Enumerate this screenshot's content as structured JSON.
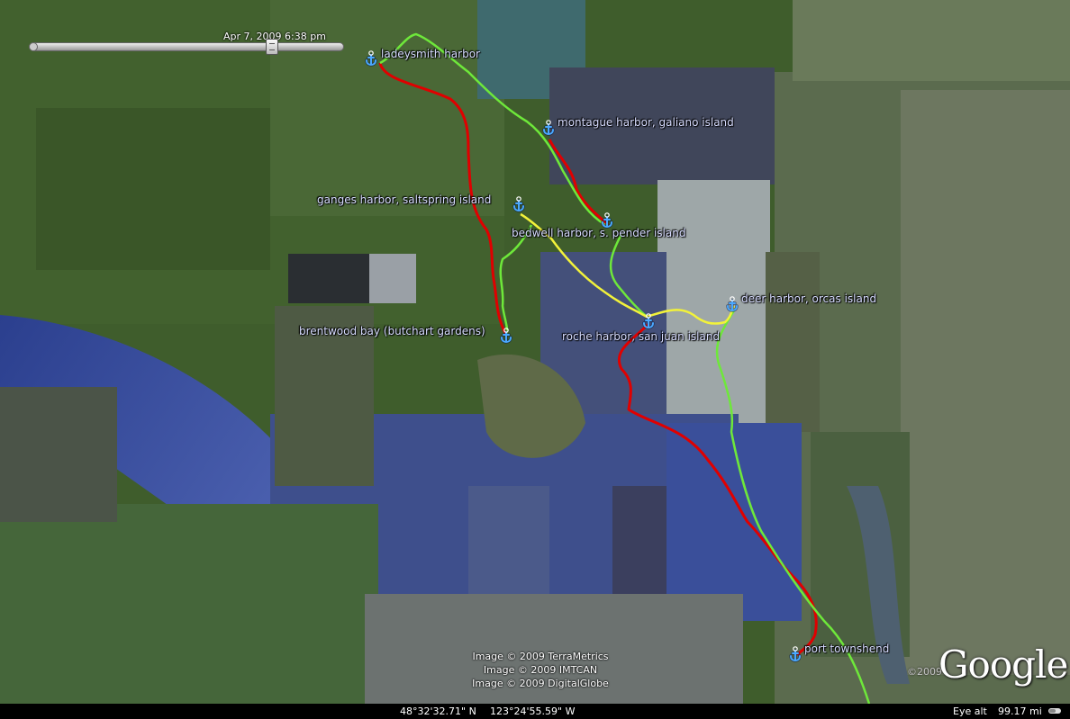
{
  "timestamp": "Apr  7, 2009  6:38 pm",
  "harbors": [
    {
      "id": "ladeysmith",
      "label": "ladeysmith harbor"
    },
    {
      "id": "montague",
      "label": "montague harbor, galiano island"
    },
    {
      "id": "ganges",
      "label": "ganges harbor, saltspring island"
    },
    {
      "id": "bedwell",
      "label": "bedwell harbor, s. pender island"
    },
    {
      "id": "deer",
      "label": "deer harbor, orcas island"
    },
    {
      "id": "brentwood",
      "label": "brentwood bay (butchart gardens)"
    },
    {
      "id": "roche",
      "label": "roche harbor, san juan island"
    },
    {
      "id": "townshend",
      "label": "port townshend"
    }
  ],
  "credits": [
    "Image © 2009 TerraMetrics",
    "Image © 2009 IMTCAN",
    "Image © 2009 DigitalGlobe"
  ],
  "copyright_year": "©2009",
  "logo": "Google",
  "status": {
    "latitude": "48°32'32.71\" N",
    "longitude": "123°24'55.59\" W",
    "eye_alt_label": "Eye alt",
    "eye_alt_value": "99.17 mi"
  },
  "colors": {
    "route_red": "#e00000",
    "route_green": "#6ee83a",
    "route_yellow": "#f2f23a",
    "pin": "#4aa8ff",
    "label": "#d7dcff",
    "water": "#3a4f9a",
    "land": "#3d5a2a"
  },
  "icons": {
    "pin": "anchor-icon",
    "slider": "time-slider-handle-icon",
    "status": "streaming-indicator-icon"
  }
}
